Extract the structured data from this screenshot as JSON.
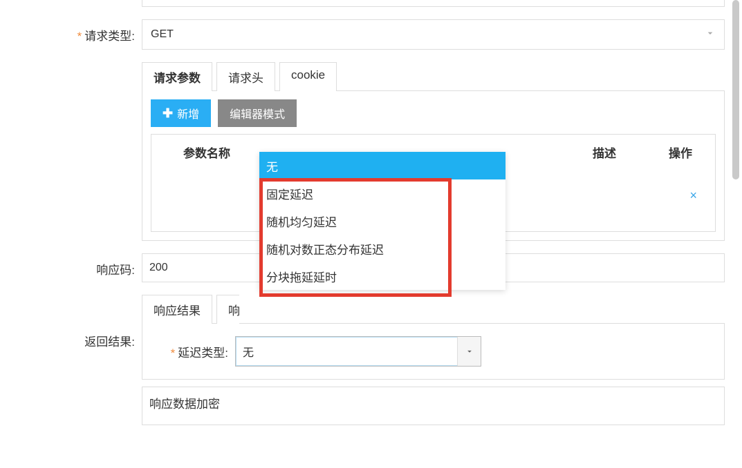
{
  "labels": {
    "request_type": "请求类型:",
    "response_code": "响应码:",
    "return_result": "返回结果:",
    "delay_type": "延迟类型:"
  },
  "request_type_value": "GET",
  "response_code_value": "200",
  "tabs_request": {
    "params": "请求参数",
    "headers": "请求头",
    "cookie": "cookie"
  },
  "buttons": {
    "add": "新增",
    "editor_mode": "编辑器模式"
  },
  "table_headers": {
    "name": "参数名称",
    "desc": "描述",
    "ops": "操作"
  },
  "tabs_response": {
    "result": "响应结果",
    "second_cut": "响"
  },
  "delay_select_value": "无",
  "delay_options": {
    "none": "无",
    "fixed": "固定延迟",
    "uniform": "随机均匀延迟",
    "lognormal": "随机对数正态分布延迟",
    "chunked": "分块拖延延时"
  },
  "encrypt_title": "响应数据加密"
}
